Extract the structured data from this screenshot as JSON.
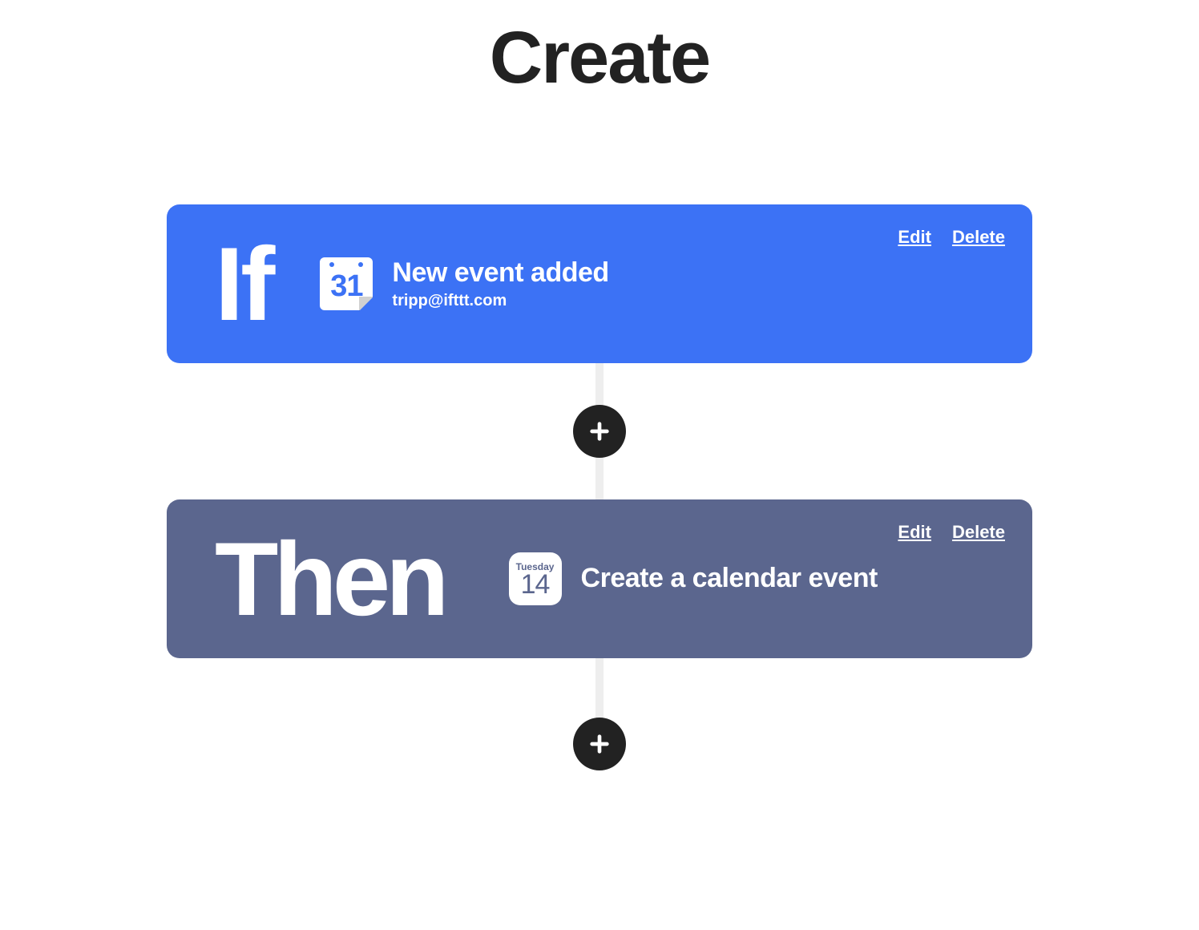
{
  "page": {
    "title": "Create"
  },
  "flow": {
    "if": {
      "prefix": "If",
      "icon_day_number": "31",
      "title": "New event added",
      "subtitle": "tripp@ifttt.com",
      "edit_label": "Edit",
      "delete_label": "Delete"
    },
    "then": {
      "prefix": "Then",
      "icon_day_name": "Tuesday",
      "icon_day_number": "14",
      "title": "Create a calendar event",
      "edit_label": "Edit",
      "delete_label": "Delete"
    }
  }
}
